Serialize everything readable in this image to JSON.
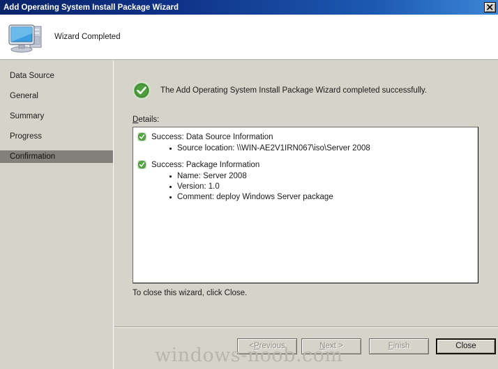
{
  "window": {
    "title": "Add Operating System Install Package Wizard",
    "close_icon": "close-x-icon"
  },
  "header": {
    "icon": "computer-monitor-icon",
    "label": "Wizard Completed"
  },
  "sidebar": {
    "items": [
      {
        "label": "Data Source",
        "current": false
      },
      {
        "label": "General",
        "current": false
      },
      {
        "label": "Summary",
        "current": false
      },
      {
        "label": "Progress",
        "current": false
      },
      {
        "label": "Confirmation",
        "current": true
      }
    ]
  },
  "main": {
    "result_icon": "success-check-icon",
    "result_text": "The Add Operating System Install Package Wizard completed successfully.",
    "details_label_prefix": "D",
    "details_label_rest": "etails:",
    "details": [
      {
        "icon": "success-check-icon",
        "heading": "Success: Data Source Information",
        "bullets": [
          "Source location: \\\\WIN-AE2V1IRN067\\iso\\Server 2008"
        ]
      },
      {
        "icon": "success-check-icon",
        "heading": "Success: Package Information",
        "bullets": [
          "Name: Server 2008",
          "Version: 1.0",
          "Comment: deploy Windows Server package"
        ]
      }
    ],
    "close_hint": "To close this wizard, click Close."
  },
  "buttons": {
    "previous": {
      "prefix": "< ",
      "accesskey": "P",
      "rest": "revious",
      "disabled": true
    },
    "next": {
      "prefix": "",
      "accesskey": "N",
      "rest": "ext >",
      "disabled": true
    },
    "finish": {
      "prefix": "",
      "accesskey": "F",
      "rest": "inish",
      "disabled": true
    },
    "close": {
      "label": "Close",
      "disabled": false,
      "default": true
    }
  },
  "watermark": {
    "text": "windows-noob.com"
  },
  "colors": {
    "titlebar_start": "#0a246a",
    "titlebar_end": "#3d86d6",
    "face": "#d6d3ca",
    "selection": "#82807a",
    "success_green": "#4caf3d"
  }
}
